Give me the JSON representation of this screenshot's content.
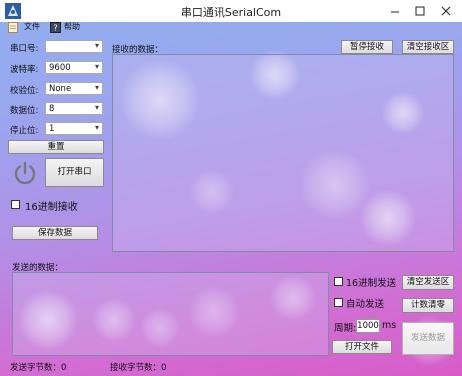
{
  "window": {
    "title": "串口通讯SerialCom"
  },
  "menu": {
    "file": "文件",
    "help": "帮助"
  },
  "settings": {
    "port_label": "串口号:",
    "port_value": "",
    "baud_label": "波特率:",
    "baud_value": "9600",
    "parity_label": "校验位:",
    "parity_value": "None",
    "databits_label": "数据位:",
    "databits_value": "8",
    "stopbits_label": "停止位:",
    "stopbits_value": "1"
  },
  "buttons": {
    "reset": "重置",
    "open_port": "打开串口",
    "save_data": "保存数据",
    "pause_receive": "暂停接收",
    "clear_receive": "清空接收区",
    "clear_send": "清空发送区",
    "reset_count": "计数清零",
    "open_file": "打开文件",
    "send_data": "发送数据"
  },
  "options": {
    "hex_receive": "16进制接收",
    "hex_send": "16进制发送",
    "auto_send": "自动发送",
    "period_label": "周期:",
    "period_value": "1000",
    "period_unit": "ms"
  },
  "receive": {
    "label": "接收的数据：",
    "content": ""
  },
  "send": {
    "label": "发送的数据：",
    "content": ""
  },
  "status": {
    "sent_bytes": "发送字节数：0",
    "received_bytes": "接收字节数：0"
  },
  "colors": {
    "window_gradient_top": "#8fb0f0",
    "window_gradient_bottom": "#d85cc8"
  }
}
